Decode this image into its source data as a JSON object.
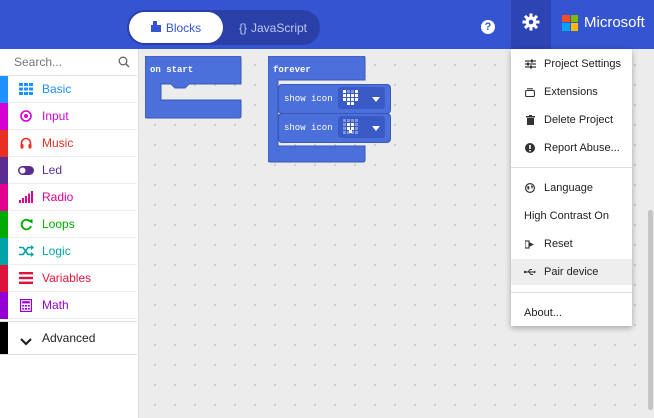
{
  "toolbar": {
    "blocks_label": "Blocks",
    "javascript_label": "JavaScript",
    "javascript_prefix": "{}",
    "help": "?",
    "brand": "Microsoft"
  },
  "sidebar": {
    "search_placeholder": "Search...",
    "categories": [
      {
        "label": "Basic",
        "color": "#1e90ff"
      },
      {
        "label": "Input",
        "color": "#d400d4"
      },
      {
        "label": "Music",
        "color": "#e63022"
      },
      {
        "label": "Led",
        "color": "#5c2d91"
      },
      {
        "label": "Radio",
        "color": "#e3008c"
      },
      {
        "label": "Loops",
        "color": "#00aa00"
      },
      {
        "label": "Logic",
        "color": "#00a4a6"
      },
      {
        "label": "Variables",
        "color": "#dc143c"
      },
      {
        "label": "Math",
        "color": "#9400d3"
      }
    ],
    "advanced_label": "Advanced"
  },
  "workspace": {
    "on_start_label": "on start",
    "forever_label": "forever",
    "show_icon_label": "show icon",
    "block_color": "#4b6fdb"
  },
  "settings_menu": {
    "items": [
      {
        "label": "Project Settings",
        "icon": "sliders-icon"
      },
      {
        "label": "Extensions",
        "icon": "extensions-icon"
      },
      {
        "label": "Delete Project",
        "icon": "trash-icon"
      },
      {
        "label": "Report Abuse...",
        "icon": "alert-icon"
      },
      {
        "label": "Language",
        "icon": "globe-icon"
      },
      {
        "label": "High Contrast On",
        "icon": ""
      },
      {
        "label": "Reset",
        "icon": "reset-icon"
      },
      {
        "label": "Pair device",
        "icon": "usb-icon"
      },
      {
        "label": "About...",
        "icon": ""
      }
    ]
  }
}
